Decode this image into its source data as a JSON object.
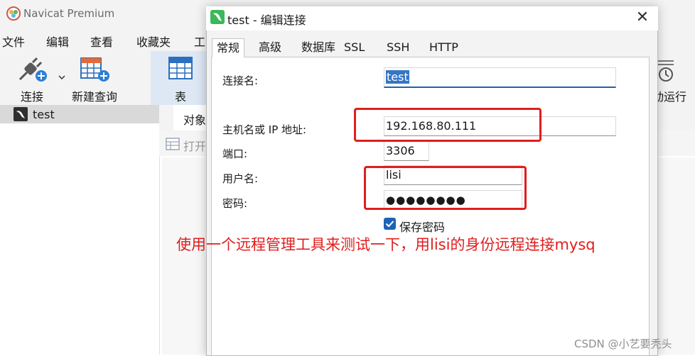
{
  "app": {
    "title": "Navicat Premium",
    "menu": [
      "文件",
      "编辑",
      "查看",
      "收藏夹",
      "工"
    ],
    "toolbar": {
      "connect": "连接",
      "new_query": "新建查询",
      "table": "表",
      "right_label": "动运行"
    },
    "sidebar": {
      "connection": "test"
    },
    "main": {
      "tab_objects": "对象",
      "open_button": "打开"
    }
  },
  "dialog": {
    "title": "test - 编辑连接",
    "close": "✕",
    "tabs": [
      "常规",
      "高级",
      "数据库",
      "SSL",
      "SSH",
      "HTTP"
    ],
    "active_tab": "常规",
    "fields": {
      "connection_name": {
        "label": "连接名:",
        "value": "test"
      },
      "host": {
        "label": "主机名或 IP 地址:",
        "value": "192.168.80.111"
      },
      "port": {
        "label": "端口:",
        "value": "3306"
      },
      "username": {
        "label": "用户名:",
        "value": "lisi"
      },
      "password": {
        "label": "密码:",
        "value": "●●●●●●●●"
      }
    },
    "save_password": {
      "label": "保存密码",
      "checked": true
    }
  },
  "annotation": "使用一个远程管理工具来测试一下，用lisi的身份远程连接mysq",
  "watermark": "CSDN @小艺要秃头",
  "colors": {
    "accent": "#1c63b7",
    "annotation_red": "#e11d1d",
    "navicat_green": "#3bb85a"
  }
}
